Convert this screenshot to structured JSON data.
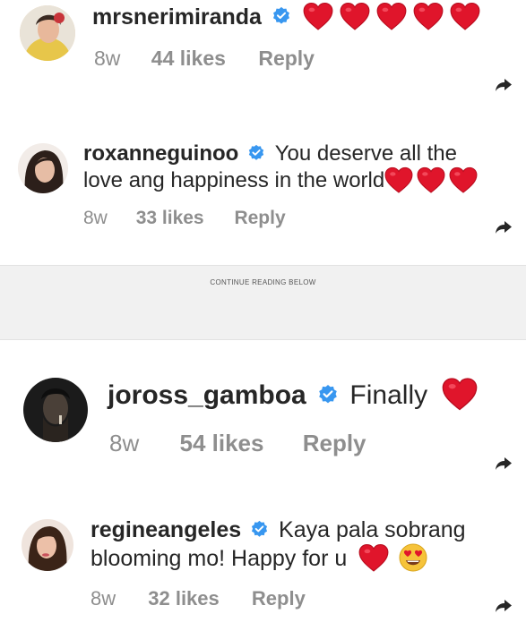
{
  "comments": [
    {
      "username": "mrsnerimiranda",
      "text": "",
      "hearts": 5,
      "time": "8w",
      "likes": "44 likes",
      "reply": "Reply"
    },
    {
      "username": "roxanneguinoo",
      "text_line1": "You deserve all the",
      "text_line2": "love ang happiness in the world",
      "hearts": 3,
      "time": "8w",
      "likes": "33 likes",
      "reply": "Reply"
    },
    {
      "username": "joross_gamboa",
      "text": "Finally",
      "hearts": 1,
      "time": "8w",
      "likes": "54 likes",
      "reply": "Reply"
    },
    {
      "username": "regineangeles",
      "text_line1": "Kaya pala sobrang",
      "text_line2": "blooming mo! Happy for u",
      "hearts": 1,
      "emoji": "heart-eyes",
      "time": "8w",
      "likes": "32 likes",
      "reply": "Reply"
    }
  ],
  "ad_divider": {
    "label": "CONTINUE READING BELOW"
  },
  "colors": {
    "heart": "#e0152b",
    "verified": "#3897f0",
    "meta": "#8e8e8e",
    "text": "#262626"
  }
}
